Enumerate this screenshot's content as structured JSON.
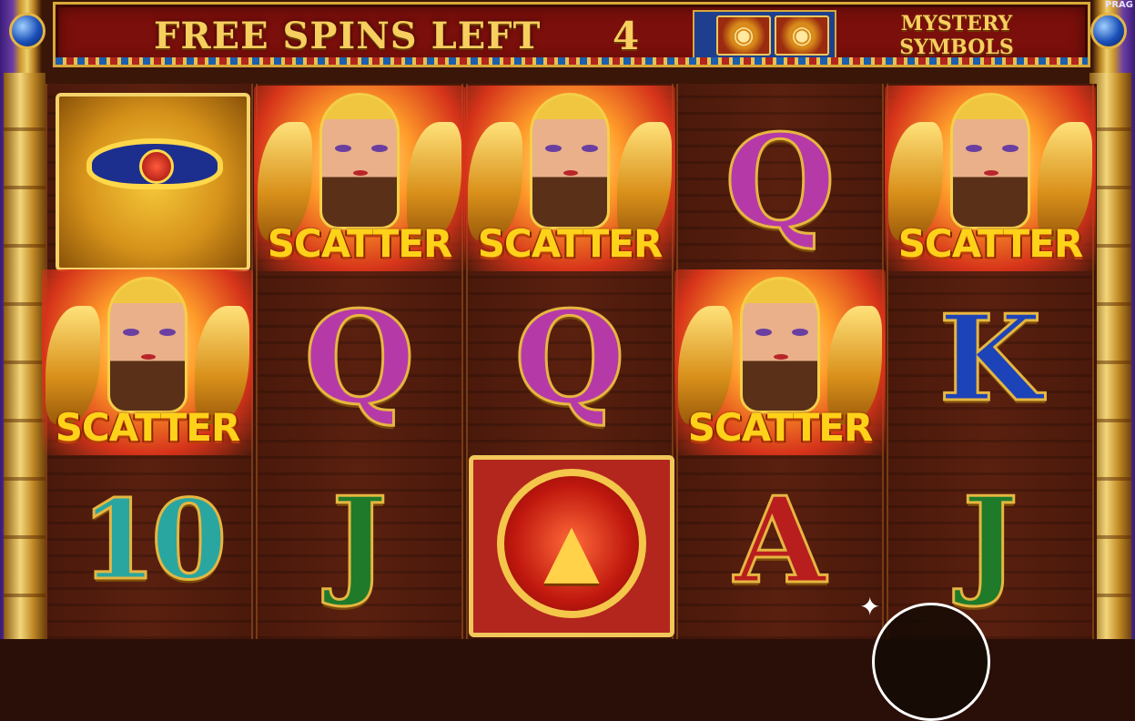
{
  "header": {
    "free_spins_label": "FREE SPINS LEFT",
    "free_spins_count": "4",
    "mystery_line1": "MYSTERY",
    "mystery_line2": "SYMBOLS",
    "brand": "PRAG",
    "mystery_icons": [
      "cat-icon",
      "eye-of-horus-icon"
    ]
  },
  "reels": {
    "columns": 5,
    "rows": 3,
    "grid": [
      [
        "eye-of-horus",
        "scatter",
        "10"
      ],
      [
        "scatter",
        "Q",
        "J"
      ],
      [
        "scatter",
        "Q",
        "cat"
      ],
      [
        "Q",
        "scatter",
        "A"
      ],
      [
        "scatter",
        "K",
        "J"
      ]
    ],
    "scatter_label": "SCATTER",
    "letters": {
      "q": "Q",
      "k": "K",
      "j": "J",
      "a": "A",
      "ten": "10"
    }
  },
  "colors": {
    "banner_bg": "#7a0f0b",
    "gold": "#f6cf5e",
    "q_color": "#b53aa8",
    "k_color": "#1d43b8",
    "j_color": "#1f7a2a",
    "a_color": "#b81e1e",
    "ten_color": "#2aa6a0"
  }
}
